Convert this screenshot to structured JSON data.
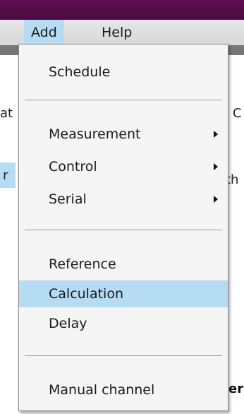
{
  "menubar": {
    "add_label": "Add",
    "help_label": "Help"
  },
  "background": {
    "frag1": "at",
    "frag2": "C",
    "frag3": "r",
    "frag4": "th",
    "frag5": "er"
  },
  "dropdown": {
    "schedule": "Schedule",
    "measurement": "Measurement",
    "control": "Control",
    "serial": "Serial",
    "reference": "Reference",
    "calculation": "Calculation",
    "delay": "Delay",
    "manual_channel": "Manual channel"
  },
  "colors": {
    "highlight": "#b6dcf4",
    "titlebar": "#5e0f52"
  },
  "icons": {
    "submenu": "chevron-right-icon"
  }
}
